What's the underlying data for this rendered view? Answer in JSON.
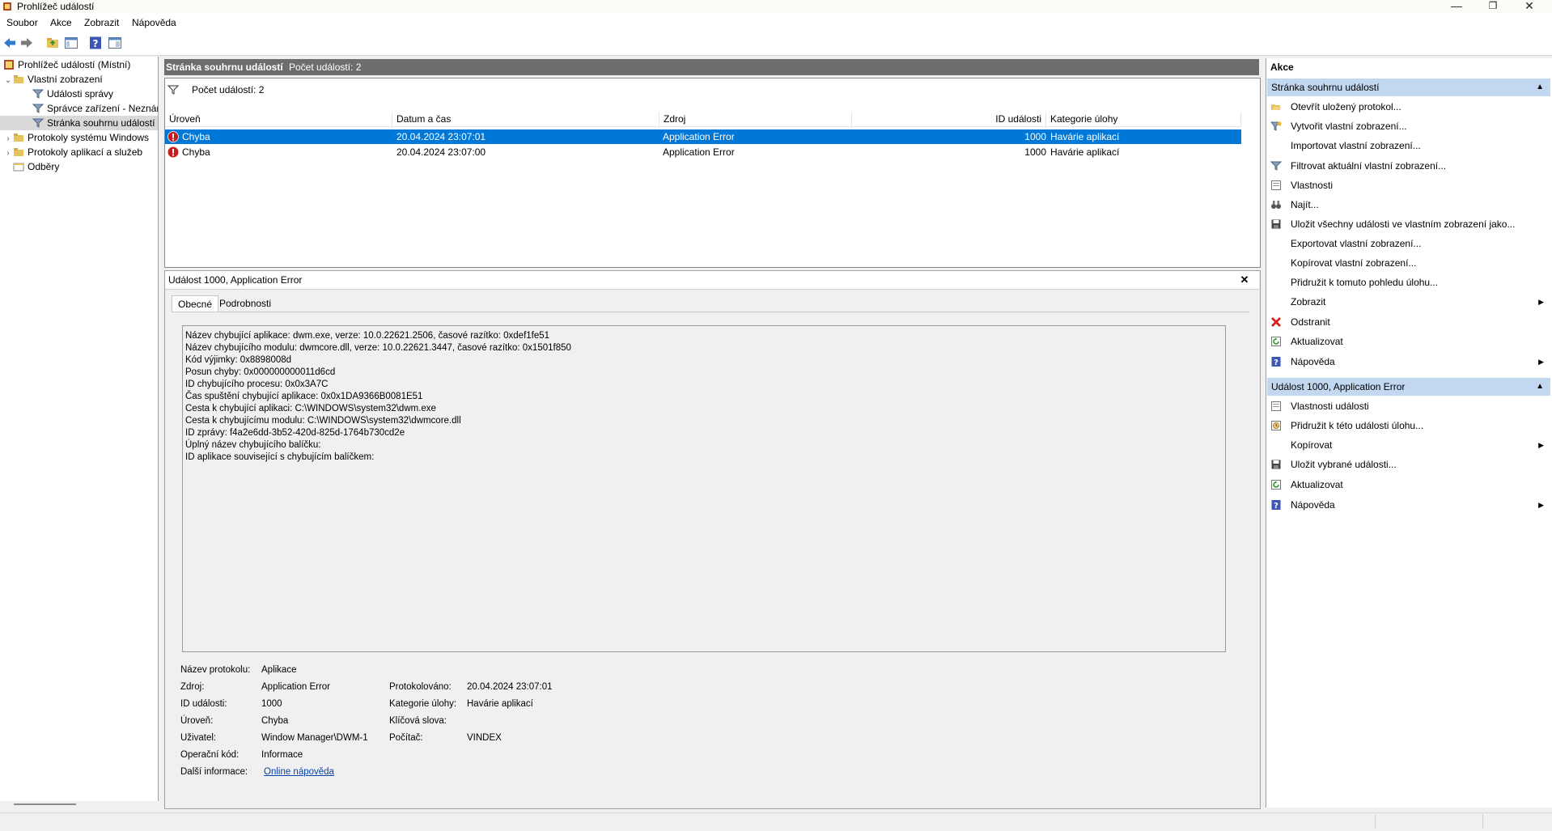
{
  "window": {
    "title": "Prohlížeč událostí",
    "min": "—",
    "max": "❐",
    "close": "✕"
  },
  "menu": [
    "Soubor",
    "Akce",
    "Zobrazit",
    "Nápověda"
  ],
  "tree": {
    "root": "Prohlížeč událostí (Místní)",
    "custom_views": "Vlastní zobrazení",
    "admin_events": "Události správy",
    "device_manager": "Správce zařízení - Neznár",
    "summary_page": "Stránka souhrnu událostí",
    "windows_logs": "Protokoly systému Windows",
    "app_service_logs": "Protokoly aplikací a služeb",
    "subscriptions": "Odběry"
  },
  "center": {
    "header_title": "Stránka souhrnu událostí",
    "header_count": "Počet událostí: 2",
    "filter_count": "Počet událostí: 2",
    "columns": [
      "Úroveň",
      "Datum a čas",
      "Zdroj",
      "ID události",
      "Kategorie úlohy"
    ],
    "rows": [
      {
        "level": "Chyba",
        "datetime": "20.04.2024 23:07:01",
        "source": "Application Error",
        "id": "1000",
        "category": "Havárie aplikací"
      },
      {
        "level": "Chyba",
        "datetime": "20.04.2024 23:07:00",
        "source": "Application Error",
        "id": "1000",
        "category": "Havárie aplikací"
      }
    ]
  },
  "detail": {
    "title": "Událost 1000, Application Error",
    "close": "✕",
    "tabs": [
      "Obecné",
      "Podrobnosti"
    ],
    "description": [
      "Název chybující aplikace: dwm.exe, verze: 10.0.22621.2506, časové razítko: 0xdef1fe51",
      "Název chybujícího modulu: dwmcore.dll, verze: 10.0.22621.3447, časové razítko: 0x1501f850",
      "Kód výjimky: 0x8898008d",
      "Posun chyby: 0x000000000011d6cd",
      "ID chybujícího procesu: 0x0x3A7C",
      "Čas spuštění chybující aplikace: 0x0x1DA9366B0081E51",
      "Cesta k chybující aplikaci: C:\\WINDOWS\\system32\\dwm.exe",
      "Cesta k chybujícímu modulu: C:\\WINDOWS\\system32\\dwmcore.dll",
      "ID zprávy: f4a2e6dd-3b52-420d-825d-1764b730cd2e",
      "Úplný název chybujícího balíčku:",
      "ID aplikace související s chybujícím balíčkem:"
    ],
    "fields": {
      "log_name_label": "Název protokolu:",
      "log_name": "Aplikace",
      "source_label": "Zdroj:",
      "source": "Application Error",
      "logged_label": "Protokolováno:",
      "logged": "20.04.2024 23:07:01",
      "event_id_label": "ID události:",
      "event_id": "1000",
      "task_cat_label": "Kategorie úlohy:",
      "task_cat": "Havárie aplikací",
      "level_label": "Úroveň:",
      "level": "Chyba",
      "keywords_label": "Klíčová slova:",
      "user_label": "Uživatel:",
      "user": "Window Manager\\DWM-1",
      "computer_label": "Počítač:",
      "computer": "VINDEX",
      "opcode_label": "Operační kód:",
      "opcode": "Informace",
      "more_info_label": "Další informace:",
      "more_info_link": "Online nápověda"
    }
  },
  "actions": {
    "title": "Akce",
    "section1": "Stránka souhrnu událostí",
    "items1": [
      "Otevřít uložený protokol...",
      "Vytvořit vlastní zobrazení...",
      "Importovat vlastní zobrazení...",
      "Filtrovat aktuální vlastní zobrazení...",
      "Vlastnosti",
      "Najít...",
      "Uložit všechny události ve vlastním zobrazení jako...",
      "Exportovat vlastní zobrazení...",
      "Kopírovat vlastní zobrazení...",
      "Přidružit k tomuto pohledu úlohu...",
      "Zobrazit",
      "Odstranit",
      "Aktualizovat",
      "Nápověda"
    ],
    "section2": "Událost 1000, Application Error",
    "items2": [
      "Vlastnosti události",
      "Přidružit k této události úlohu...",
      "Kopírovat",
      "Uložit vybrané události...",
      "Aktualizovat",
      "Nápověda"
    ]
  },
  "colors": {
    "selection": "#0078d7",
    "section_header": "#c2d8f0",
    "pane_header": "#6d6d6d",
    "error_red": "#c41e1e",
    "link": "#0645ad"
  }
}
